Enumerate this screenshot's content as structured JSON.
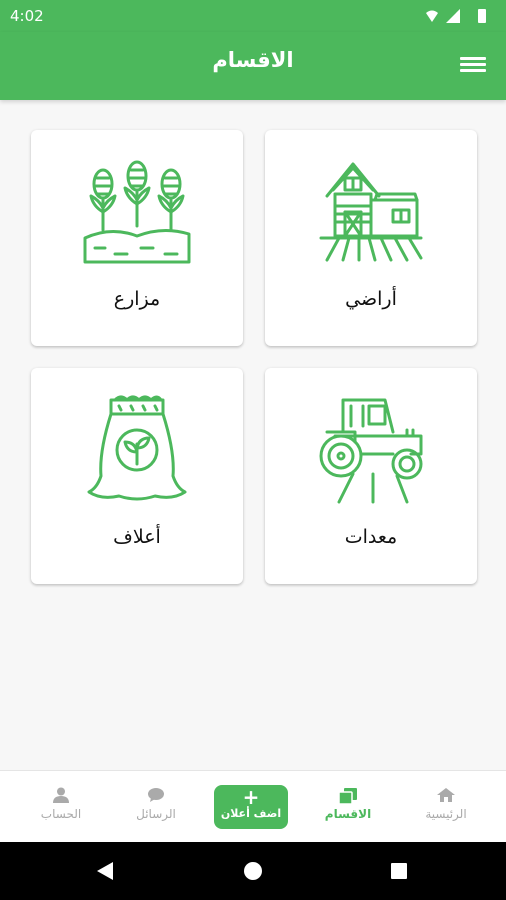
{
  "status_bar": {
    "time": "4:02"
  },
  "app_bar": {
    "title": "الاقسام",
    "menu_icon": "hamburger-menu-icon"
  },
  "categories": [
    {
      "label": "أراضي",
      "icon": "farmhouse-icon"
    },
    {
      "label": "مزارع",
      "icon": "crops-field-icon"
    },
    {
      "label": "معدات",
      "icon": "tractor-icon"
    },
    {
      "label": "أعلاف",
      "icon": "feed-sack-icon"
    }
  ],
  "bottom_nav": {
    "home": "الرئيسية",
    "sections": "الاقسام",
    "add_ad_plus": "+",
    "add_ad": "اضف أعلان",
    "messages": "الرسائل",
    "account": "الحساب"
  },
  "colors": {
    "primary": "#4cb85c",
    "inactive": "#aaaaaa"
  }
}
